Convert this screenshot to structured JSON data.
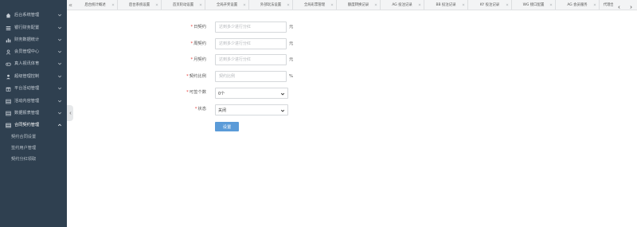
{
  "sidebar": {
    "items": [
      {
        "label": "后台系统管理",
        "icon": "home-icon"
      },
      {
        "label": "银行财务配置",
        "icon": "list-icon"
      },
      {
        "label": "财务数据统计",
        "icon": "chart-icon"
      },
      {
        "label": "会员管理中心",
        "icon": "user-icon"
      },
      {
        "label": "真人视讯体育",
        "icon": "gamepad-icon"
      },
      {
        "label": "超级管理控制",
        "icon": "admin-icon"
      },
      {
        "label": "平台活动管理",
        "icon": "gift-icon"
      },
      {
        "label": "活动内容管理",
        "icon": "table-icon"
      },
      {
        "label": "数据报表管理",
        "icon": "table-icon"
      },
      {
        "label": "合同契约管理",
        "icon": "table-icon"
      }
    ],
    "subitems": [
      "契约合同设置",
      "签约用户管理",
      "契约分红领取"
    ]
  },
  "tabs": [
    "后台统计概述",
    "后台系统设置",
    "首页轮动设置",
    "全局开奖设置",
    "外部玩法设置",
    "全局彩票管理",
    "额度转换记录",
    "AG 投注记录",
    "BB 投注记录",
    "KY 投注记录",
    "WG 接口配置",
    "AG 会员服务",
    "代理合同"
  ],
  "form": {
    "fields": [
      {
        "label": "日契约",
        "required": true,
        "placeholder": "达到多少进行分红",
        "value": "",
        "unit": "元"
      },
      {
        "label": "周契约",
        "required": true,
        "placeholder": "达到多少进行分红",
        "value": "",
        "unit": "元"
      },
      {
        "label": "月契约",
        "required": true,
        "placeholder": "达到多少进行分红",
        "value": "",
        "unit": "元"
      },
      {
        "label": "契约比例",
        "required": true,
        "placeholder": "契约比例",
        "value": "",
        "unit": "%"
      }
    ],
    "selects": [
      {
        "label": "可签个数",
        "required": true,
        "value": "0个"
      },
      {
        "label": "状态",
        "required": true,
        "value": "关闭"
      }
    ],
    "submit_label": "设置"
  }
}
